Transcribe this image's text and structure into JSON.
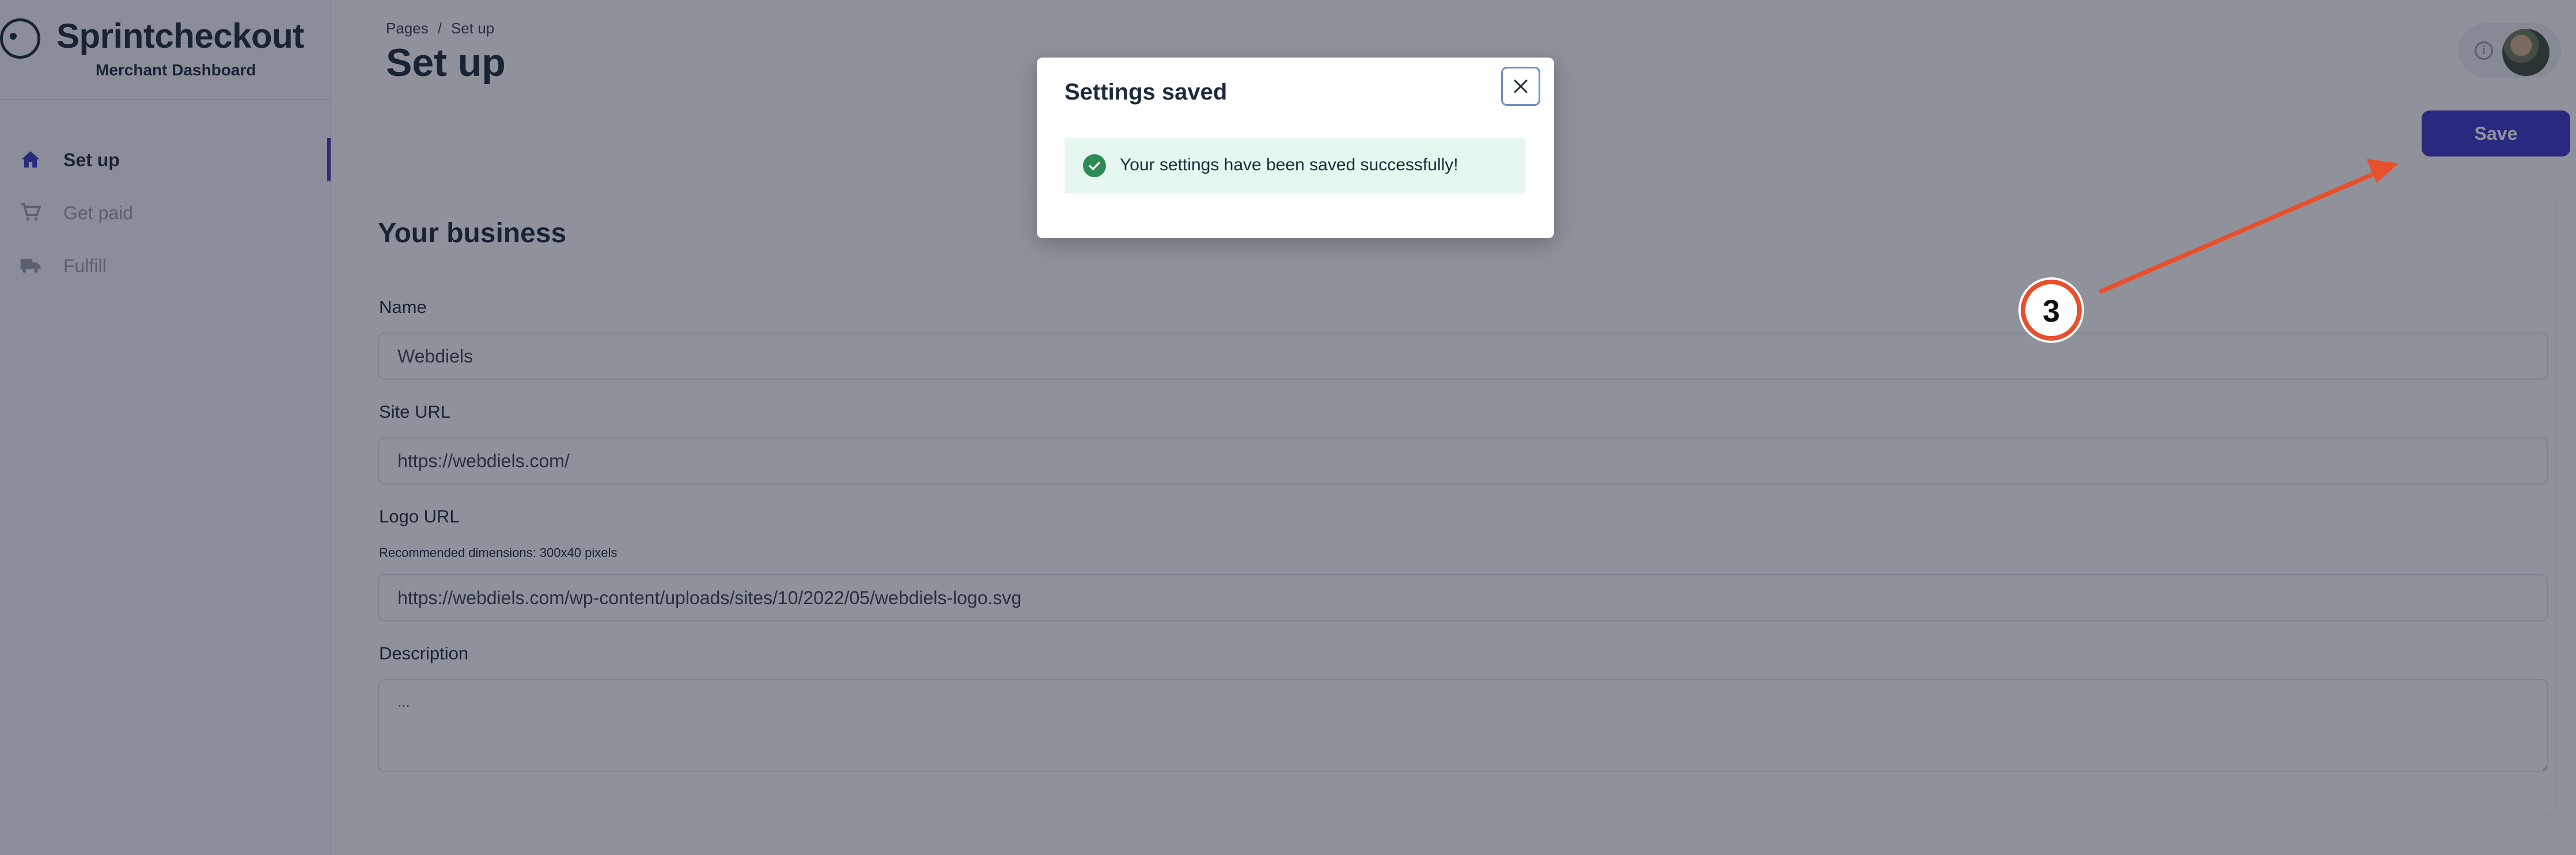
{
  "sidebar": {
    "brand_title": "Sprintcheckout",
    "brand_subtitle": "Merchant Dashboard",
    "items": [
      {
        "label": "Set up",
        "icon": "home-icon",
        "active": true
      },
      {
        "label": "Get paid",
        "icon": "cart-icon",
        "active": false
      },
      {
        "label": "Fulfill",
        "icon": "truck-icon",
        "active": false
      }
    ]
  },
  "header": {
    "breadcrumb": [
      "Pages",
      "Set up"
    ],
    "title": "Set up",
    "save_label": "Save"
  },
  "business": {
    "title": "Your business",
    "name_label": "Name",
    "name_value": "Webdiels",
    "site_label": "Site URL",
    "site_value": "https://webdiels.com/",
    "logo_label": "Logo URL",
    "logo_hint": "Recommended dimensions: 300x40 pixels",
    "logo_value": "https://webdiels.com/wp-content/uploads/sites/10/2022/05/webdiels-logo.svg",
    "description_label": "Description",
    "description_value": "..."
  },
  "modal": {
    "title": "Settings saved",
    "message": "Your settings have been saved successfully!"
  },
  "annotation": {
    "step_number": "3"
  },
  "colors": {
    "accent": "#3d36c9",
    "success_bg": "#e6f7ef",
    "success_icon": "#2e8b57",
    "annotation": "#e8502d"
  }
}
